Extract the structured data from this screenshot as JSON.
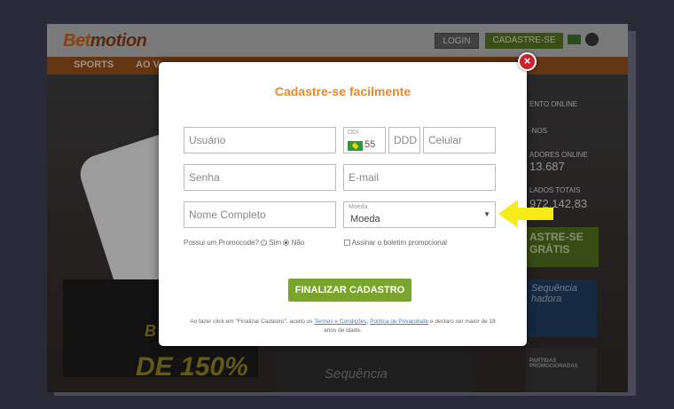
{
  "site": {
    "logo_main": "Bet",
    "logo_accent": "motion",
    "login_label": "LOGIN",
    "register_label": "CADASTRE-SE",
    "nav": [
      "SPORTS",
      "AO V"
    ],
    "side": [
      "ENTO ONLINE",
      "-NOS",
      "ADORES ONLINE",
      "13.687",
      "LADOS TOTAIS",
      "972.142,83",
      "ASTRE-SE",
      "GRÁTIS"
    ],
    "promo_left_text": "DE 150%",
    "promo_left_small": "B",
    "promo_mid_text": "Sequência",
    "promo_right_text": "Sequência hadora",
    "promo_right2_text": "PARTIDAS PROMOCIONADAS"
  },
  "modal": {
    "title": "Cadastre-se facilmente",
    "close_glyph": "×",
    "fields": {
      "username_placeholder": "Usuário",
      "ddi_label": "DDI",
      "ddi_value": "55",
      "ddd_placeholder": "DDD",
      "phone_placeholder": "Celular",
      "password_placeholder": "Senha",
      "email_placeholder": "E-mail",
      "fullname_placeholder": "Nome Completo",
      "currency_label": "Moeda",
      "currency_value": "Moeda"
    },
    "promo_question": "Possui um Promocode?",
    "promo_yes": "Sim",
    "promo_no": "Não",
    "newsletter_label": "Assinar o boletim promocional",
    "submit_label": "FINALIZAR CADASTRO",
    "legal_prefix": "Ao fazer click em \"Finalizar Cadastro\", aceito os",
    "legal_terms": "Termos e Condições",
    "legal_sep": ",",
    "legal_privacy": "Política de Privacidade",
    "legal_suffix": "e declaro ser maior de 18 anos de idade."
  },
  "colors": {
    "accent_orange": "#e88a2a",
    "submit_green": "#79a52a",
    "close_red": "#c8232c",
    "arrow_yellow": "#f5ec1a"
  }
}
